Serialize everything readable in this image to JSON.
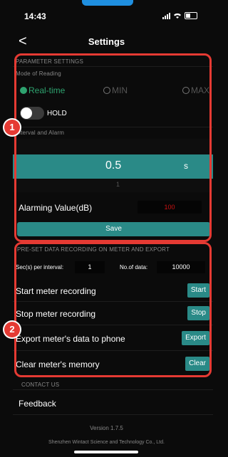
{
  "status": {
    "time": "14:43"
  },
  "nav": {
    "title": "Settings",
    "back": "<"
  },
  "params": {
    "header": "PARAMETER SETTINGS",
    "mode_label": "Mode of Reading",
    "modes": [
      "Real-time",
      "MIN",
      "MAX"
    ],
    "hold_label": "HOLD",
    "hold_on": false,
    "interval_label": "Interval and Alarm",
    "interval_value": "0.5",
    "interval_ghost": "1",
    "interval_unit": "s",
    "alarm_label": "Alarming Value(dB)",
    "alarm_value": "100",
    "save_label": "Save"
  },
  "recording": {
    "header": "PRE-SET DATA RECORDING ON METER AND EXPORT",
    "sec_label": "Sec(s) per interval:",
    "sec_value": "1",
    "count_label": "No.of data:",
    "count_value": "10000",
    "actions": [
      {
        "label": "Start meter recording",
        "button": "Start"
      },
      {
        "label": "Stop meter recording",
        "button": "Stop"
      },
      {
        "label": "Export meter's data to phone",
        "button": "Export"
      },
      {
        "label": "Clear meter's memory",
        "button": "Clear"
      }
    ]
  },
  "contact": {
    "header": "CONTACT US",
    "feedback": "Feedback"
  },
  "footer": {
    "version": "Version 1.7.5",
    "company": "Shenzhen Wintact Science and Technology Co., Ltd."
  },
  "annotations": {
    "badge1": "1",
    "badge2": "2"
  },
  "colors": {
    "accent": "#2a8a87",
    "selected": "#2ea36f",
    "annotation": "#e53a33",
    "alarm": "#cc1111"
  }
}
